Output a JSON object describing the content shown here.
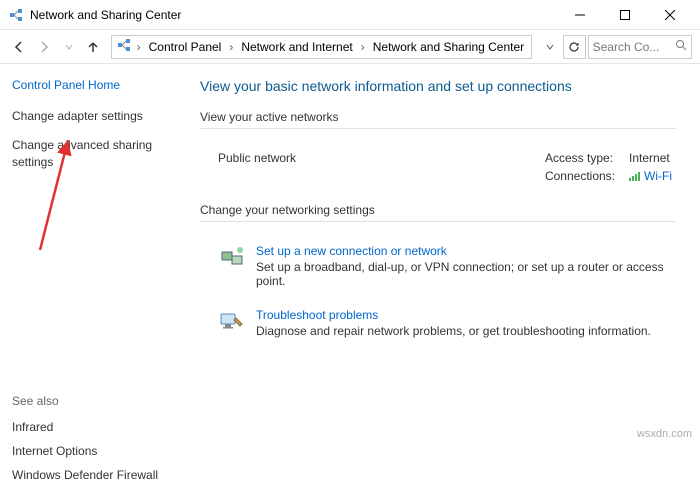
{
  "window": {
    "title": "Network and Sharing Center"
  },
  "breadcrumb": {
    "item1": "Control Panel",
    "item2": "Network and Internet",
    "item3": "Network and Sharing Center"
  },
  "search": {
    "placeholder": "Search Co..."
  },
  "sidebar": {
    "home": "Control Panel Home",
    "task1": "Change adapter settings",
    "task2": "Change advanced sharing settings",
    "see_also": "See also",
    "link1": "Infrared",
    "link2": "Internet Options",
    "link3": "Windows Defender Firewall"
  },
  "main": {
    "heading": "View your basic network information and set up connections",
    "active_section": "View your active networks",
    "network_name": "Public network",
    "access_type_label": "Access type:",
    "access_type_value": "Internet",
    "connections_label": "Connections:",
    "connections_value": "Wi-Fi",
    "change_section": "Change your networking settings",
    "setup_link": "Set up a new connection or network",
    "setup_desc": "Set up a broadband, dial-up, or VPN connection; or set up a router or access point.",
    "trouble_link": "Troubleshoot problems",
    "trouble_desc": "Diagnose and repair network problems, or get troubleshooting information."
  },
  "watermark": "wsxdn.com"
}
